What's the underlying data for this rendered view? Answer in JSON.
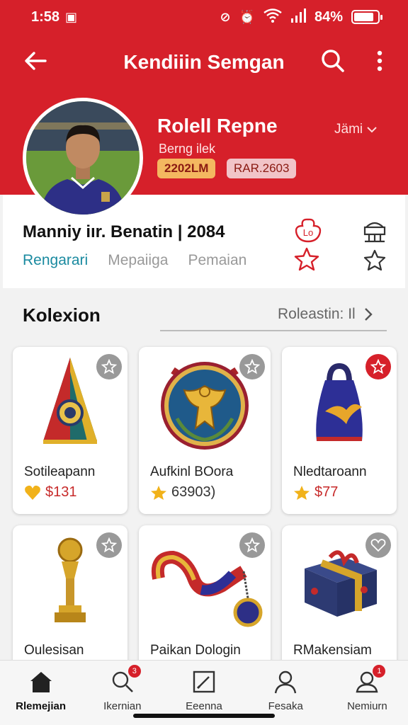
{
  "status_bar": {
    "time": "1:58",
    "battery": "84%",
    "battery_level": 0.84
  },
  "app_bar": {
    "title": "Kendiiin Semgan"
  },
  "profile": {
    "name": "Rolell Repne",
    "subtitle": "Berng ilek",
    "badge_1": "2202LM",
    "badge_2": "RAR.2603",
    "dropdown": "Jämi",
    "stats": "Manniy iır. Benatin | 2084",
    "tabs": [
      {
        "label": "Rengarari"
      },
      {
        "label": "Mepaiiga"
      },
      {
        "label": "Pemaian"
      }
    ]
  },
  "collection": {
    "title": "Kolexion",
    "filter": "Roleastin: Il",
    "items": [
      {
        "name": "Sotileapann",
        "price": "$131",
        "icon": "pennant-icon",
        "fav": false,
        "accent": "#f1b21a"
      },
      {
        "name": "Aufkinl BOora",
        "price": "63903)",
        "icon": "eagle-crest-icon",
        "fav": false,
        "accent": "#f1b21a"
      },
      {
        "name": "Nledtaroann",
        "price": "$77",
        "icon": "jersey-bag-icon",
        "fav": true,
        "accent": "#f1b21a"
      },
      {
        "name": "Oulesisan",
        "price": "",
        "icon": "trophy-icon",
        "fav": false,
        "accent": "#f1b21a"
      },
      {
        "name": "Paikan Dologin",
        "price": "",
        "icon": "lanyard-medal-icon",
        "fav": false,
        "accent": "#f1b21a"
      },
      {
        "name": "RMakensiam",
        "price": "",
        "icon": "gift-box-icon",
        "fav": false,
        "accent": "#f1b21a"
      }
    ]
  },
  "bottom_nav": [
    {
      "label": "Rlemejian",
      "icon": "home-icon",
      "badge": ""
    },
    {
      "label": "Ikernian",
      "icon": "search-icon",
      "badge": "3"
    },
    {
      "label": "Eeenna",
      "icon": "edit-icon",
      "badge": ""
    },
    {
      "label": "Fesaka",
      "icon": "person-icon",
      "badge": ""
    },
    {
      "label": "Nemiurn",
      "icon": "profile-icon",
      "badge": "1"
    }
  ],
  "colors": {
    "brand": "#d6202a",
    "tab_active": "#1a8aa0",
    "price": "#c72a2a"
  }
}
